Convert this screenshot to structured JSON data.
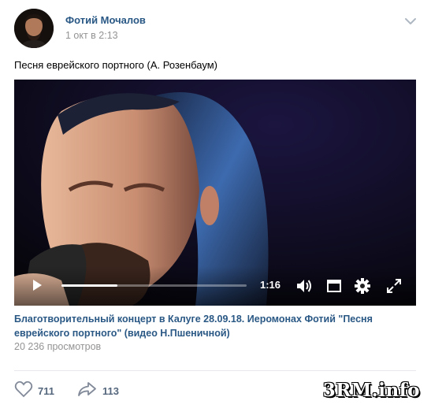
{
  "post": {
    "author": "Фотий Мочалов",
    "date": "1 окт в 2:13",
    "text": "Песня еврейского портного (А. Розенбаум)"
  },
  "video": {
    "time": "1:16",
    "progress": 0.3,
    "title": "Благотворительный концерт в Калуге 28.09.18. Иеромонах Фотий \"Песня еврейского портного\" (видео Н.Пшеничной)",
    "views": "20 236 просмотров",
    "controls": [
      "play-icon",
      "volume-icon",
      "miniplayer-icon",
      "settings-icon",
      "fullscreen-icon"
    ]
  },
  "actions": {
    "likes": "711",
    "shares": "113"
  },
  "watermark": "3RM.info",
  "colors": {
    "link": "#2a5885",
    "muted": "#939393",
    "action": "#55677d"
  }
}
